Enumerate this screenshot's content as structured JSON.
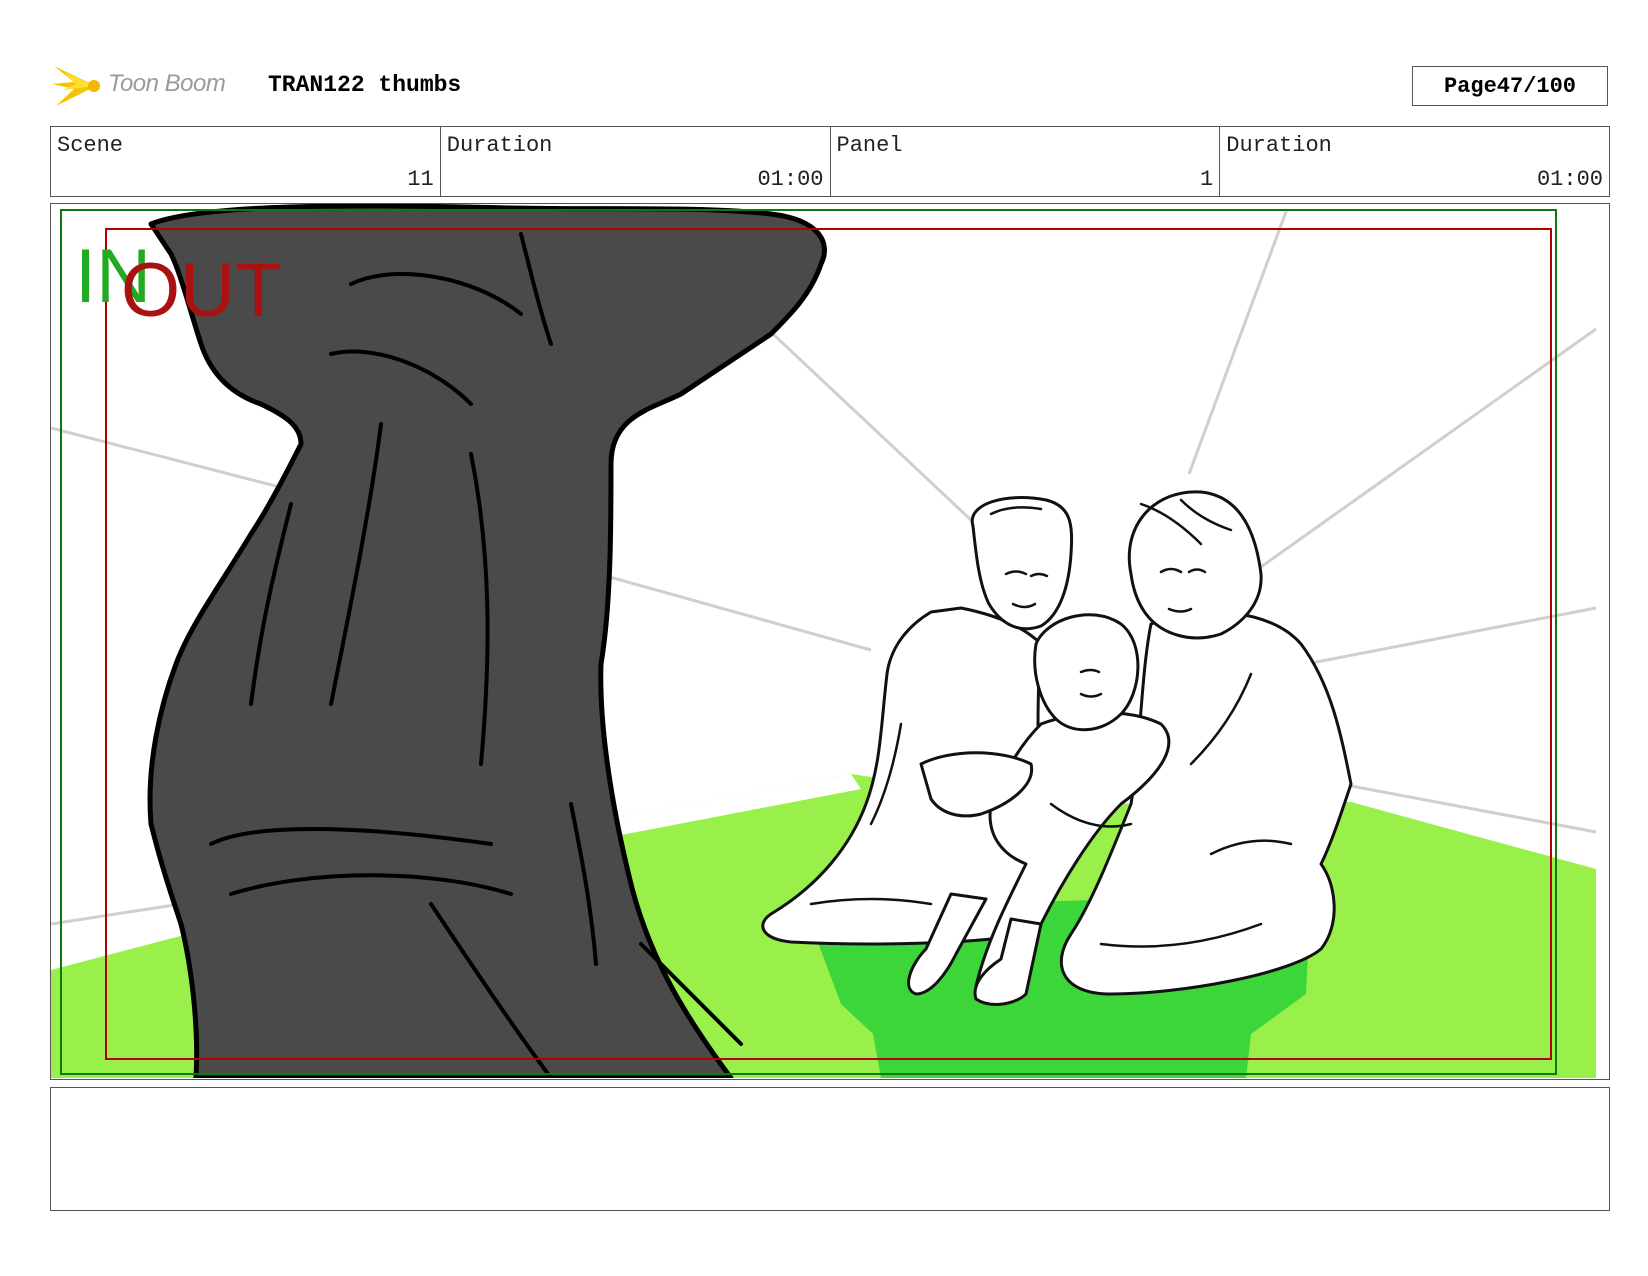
{
  "header": {
    "logo_text": "Toon Boom",
    "project_title": "TRAN122 thumbs",
    "page_label": "Page",
    "page_number": "47/100"
  },
  "info": {
    "scene_label": "Scene",
    "scene_value": "11",
    "scene_duration_label": "Duration",
    "scene_duration_value": "01:00",
    "panel_label": "Panel",
    "panel_value": "1",
    "panel_duration_label": "Duration",
    "panel_duration_value": "01:00"
  },
  "panel": {
    "in_marker": "IN",
    "out_marker": "OUT"
  },
  "notes": {
    "text": ""
  },
  "colors": {
    "in_marker": "#22aa22",
    "out_marker": "#aa1111",
    "floor_light": "#99f04a",
    "floor_shadow": "#3dd63a",
    "silhouette": "#4a4a4a"
  }
}
